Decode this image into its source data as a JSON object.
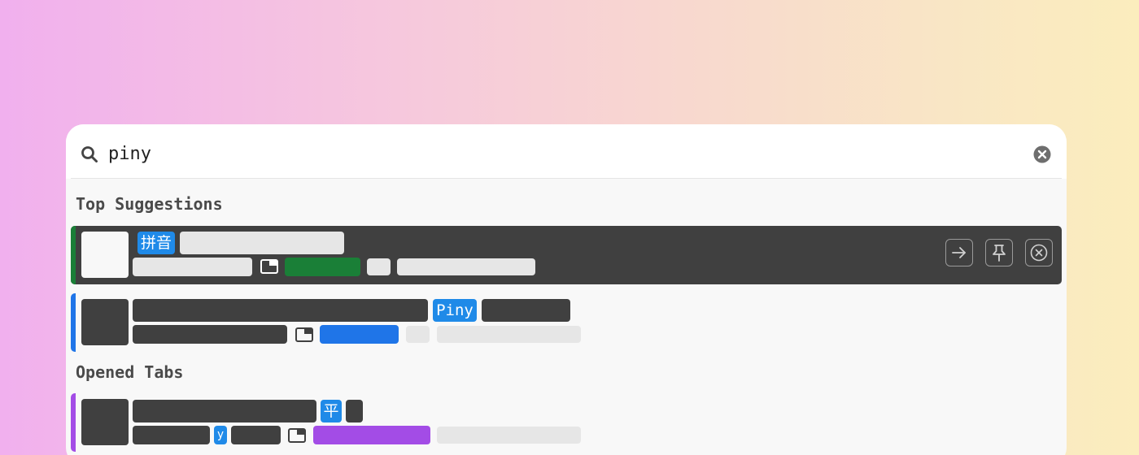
{
  "search": {
    "value": "piny",
    "placeholder": ""
  },
  "sections": {
    "top_suggestions": "Top Suggestions",
    "opened_tabs": "Opened Tabs"
  },
  "rows": [
    {
      "match_tag": "拼音",
      "accent_color": "#1a7f37",
      "badge_color": "#1a7f37"
    },
    {
      "match_tag": "Piny",
      "accent_color": "#1f75e8",
      "badge_color": "#1f75e8"
    },
    {
      "match_tag": "平",
      "url_tag": "y",
      "accent_color": "#a34ce6",
      "badge_color": "#a34ce6"
    }
  ],
  "icons": {
    "search": "search-icon",
    "clear": "clear-icon",
    "window": "window-icon",
    "open": "arrow-right-icon",
    "pin": "pin-icon",
    "close": "close-circle-icon"
  }
}
